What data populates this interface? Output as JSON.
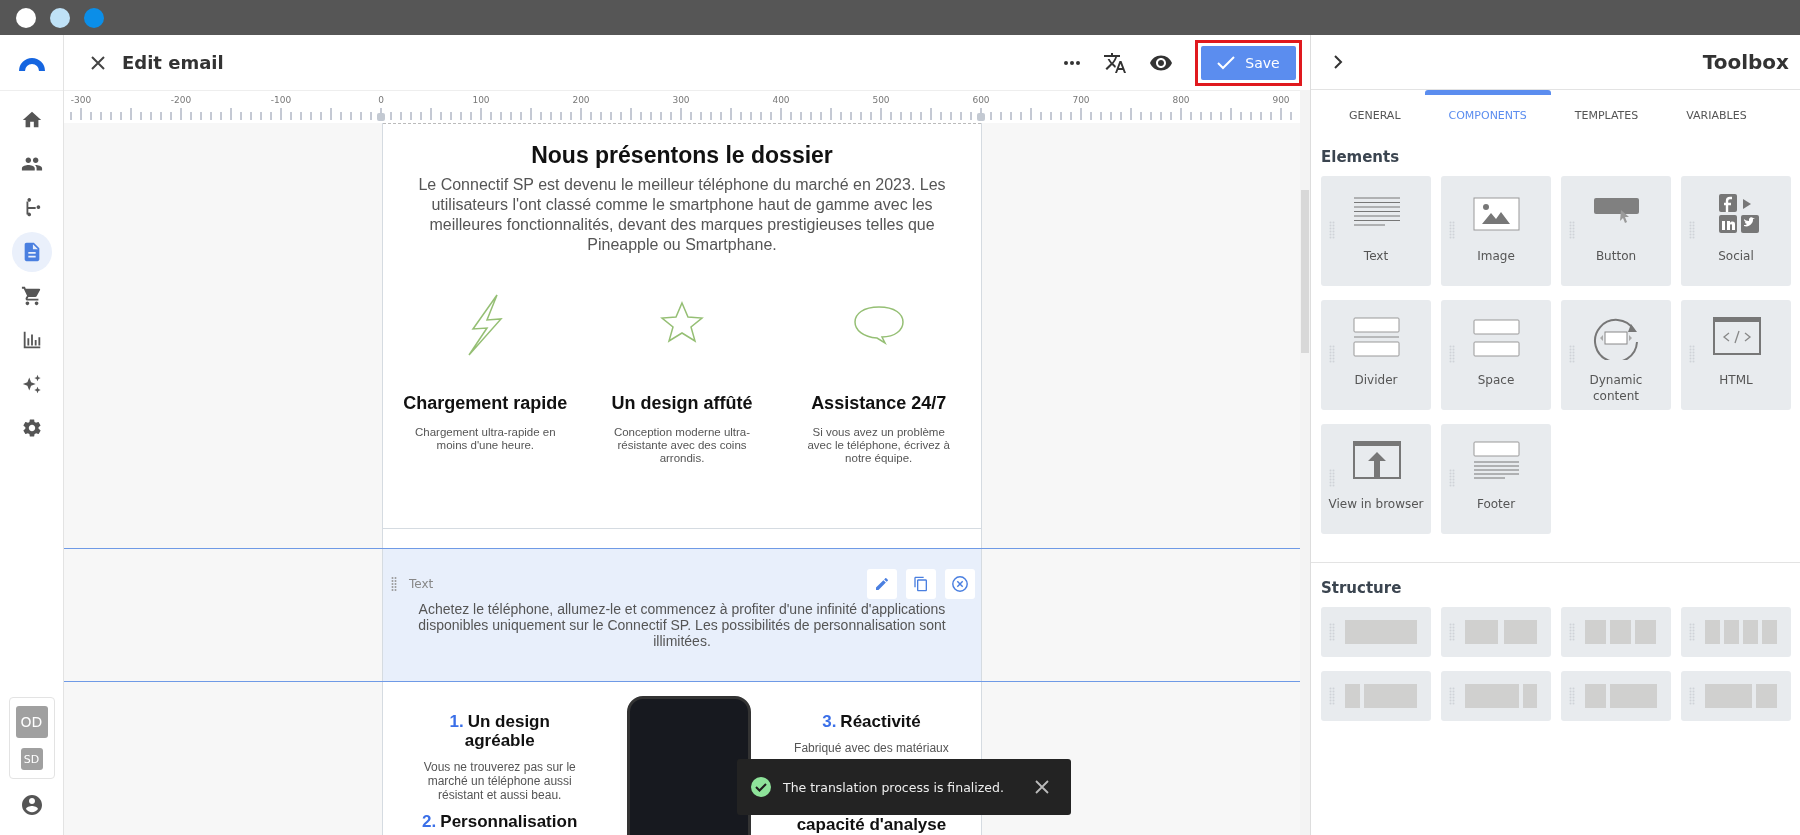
{
  "window_controls": [
    {
      "color": "#ffffff"
    },
    {
      "color": "#bfe2f7"
    },
    {
      "color": "#0b8ee8"
    }
  ],
  "sidebar": {
    "items": [
      {
        "kind": "home",
        "selected": false
      },
      {
        "kind": "people",
        "selected": false
      },
      {
        "kind": "branch",
        "selected": false
      },
      {
        "kind": "document",
        "selected": true
      },
      {
        "kind": "cart",
        "selected": false
      },
      {
        "kind": "chart",
        "selected": false
      },
      {
        "kind": "sparkles",
        "selected": false
      },
      {
        "kind": "gear",
        "selected": false
      }
    ],
    "accounts": [
      "OD",
      "SD"
    ]
  },
  "header": {
    "title": "Edit email",
    "save_label": "Save"
  },
  "ruler": {
    "labels": [
      "-300",
      "-200",
      "-100",
      "0",
      "100",
      "200",
      "300",
      "400",
      "500",
      "600",
      "700",
      "800",
      "900"
    ]
  },
  "email": {
    "heading": "Nous présentons le dossier",
    "paragraph": "Le Connectif SP est devenu le meilleur téléphone du marché en 2023. Les utilisateurs l'ont classé comme le smartphone haut de gamme avec les meilleures fonctionnalités, devant des marques prestigieuses telles que Pineapple ou Smartphane.",
    "features": [
      {
        "kind": "bolt",
        "title": "Chargement rapide",
        "text": "Chargement ultra-rapide en moins d'une heure."
      },
      {
        "kind": "star",
        "title": "Un design affûté",
        "text": "Conception moderne ultra-résistante avec des coins arrondis."
      },
      {
        "kind": "bubble",
        "title": "Assistance 24/7",
        "text": "Si vous avez un problème avec le téléphone, écrivez à notre équipe."
      }
    ],
    "selected_block": {
      "label": "Text",
      "paragraph": "Achetez le téléphone, allumez-le et commencez à profiter d'une infinité d'applications disponibles uniquement sur le Connectif SP. Les possibilités de personnalisation sont illimitées."
    },
    "left_items": [
      {
        "number": "1.",
        "title": "Un design agréable",
        "text": "Vous ne trouverez pas sur le marché un téléphone aussi résistant et aussi beau."
      },
      {
        "number": "2.",
        "title": "Personnalisation"
      }
    ],
    "right_items": [
      {
        "number": "3.",
        "title": "Réactivité",
        "text": "Fabriqué avec des matériaux"
      },
      {
        "title": "capacité d'analyse"
      }
    ]
  },
  "toast": {
    "message": "The translation process is finalized."
  },
  "toolbox": {
    "title": "Toolbox",
    "tabs": [
      {
        "label": "GENERAL",
        "selected": false
      },
      {
        "label": "COMPONENTS",
        "selected": true
      },
      {
        "label": "TEMPLATES",
        "selected": false
      },
      {
        "label": "VARIABLES",
        "selected": false
      }
    ],
    "elements_heading": "Elements",
    "elements": [
      {
        "kind": "text",
        "label": "Text"
      },
      {
        "kind": "image",
        "label": "Image"
      },
      {
        "kind": "button",
        "label": "Button"
      },
      {
        "kind": "social",
        "label": "Social"
      },
      {
        "kind": "divider",
        "label": "Divider"
      },
      {
        "kind": "space",
        "label": "Space"
      },
      {
        "kind": "dynamic",
        "label": "Dynamic content"
      },
      {
        "kind": "html",
        "label": "HTML"
      },
      {
        "kind": "browser",
        "label": "View in browser"
      },
      {
        "kind": "footer",
        "label": "Footer"
      }
    ],
    "structure_heading": "Structure",
    "structures": [
      {
        "kind": "one"
      },
      {
        "kind": "two"
      },
      {
        "kind": "three"
      },
      {
        "kind": "four"
      },
      {
        "kind": "narrow-wide"
      },
      {
        "kind": "wide-narrow"
      },
      {
        "kind": "third-twothirds"
      },
      {
        "kind": "twothirds-third"
      }
    ]
  }
}
